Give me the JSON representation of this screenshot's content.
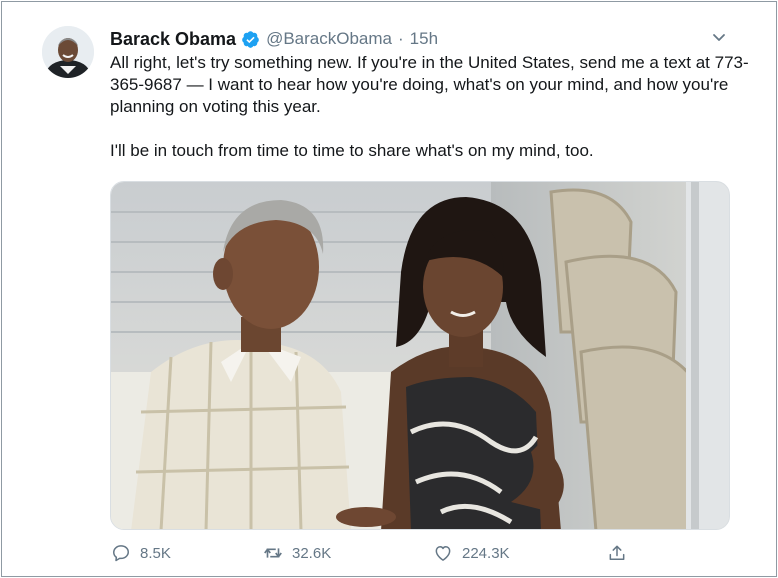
{
  "tweet": {
    "author_name": "Barack Obama",
    "handle": "@BarackObama",
    "separator": "·",
    "timestamp": "15h",
    "paragraphs": [
      "All right, let's try something new. If you're in the United States, send me a text at 773-365-9687 — I want to hear how you're doing, what's on your mind, and how you're planning on voting this year.",
      "I'll be in touch from time to time to share what's on my mind, too."
    ]
  },
  "icons": {
    "verified": "verified-badge-icon",
    "more": "chevron-down-icon",
    "reply": "reply-icon",
    "retweet": "retweet-icon",
    "like": "heart-icon",
    "share": "share-icon"
  },
  "actions": {
    "replies": "8.5K",
    "retweets": "32.6K",
    "likes": "224.3K"
  },
  "colors": {
    "primary_text": "#14171a",
    "secondary_text": "#657786",
    "verified_blue": "#1da1f2"
  }
}
